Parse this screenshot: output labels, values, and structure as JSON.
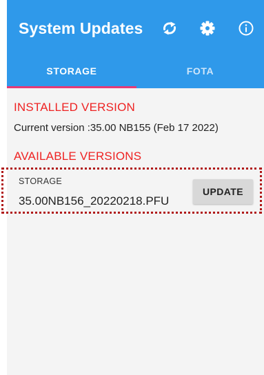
{
  "app_bar": {
    "title": "System Updates",
    "background_color": "#2f99ea",
    "icons": [
      "refresh-icon",
      "gear-icon",
      "info-icon"
    ]
  },
  "tabs": [
    {
      "label": "STORAGE",
      "selected": true
    },
    {
      "label": "FOTA",
      "selected": false
    }
  ],
  "tab_indicator_color": "#e63a76",
  "installed": {
    "heading": "INSTALLED VERSION",
    "current_version": "Current version :35.00 NB155 (Feb 17 2022)"
  },
  "available": {
    "heading": "AVAILABLE VERSIONS",
    "items": [
      {
        "source": "STORAGE",
        "filename": "35.00NB156_20220218.PFU",
        "action_label": "UPDATE"
      }
    ]
  },
  "heading_color": "#ee2222",
  "highlight_color": "#b01818"
}
